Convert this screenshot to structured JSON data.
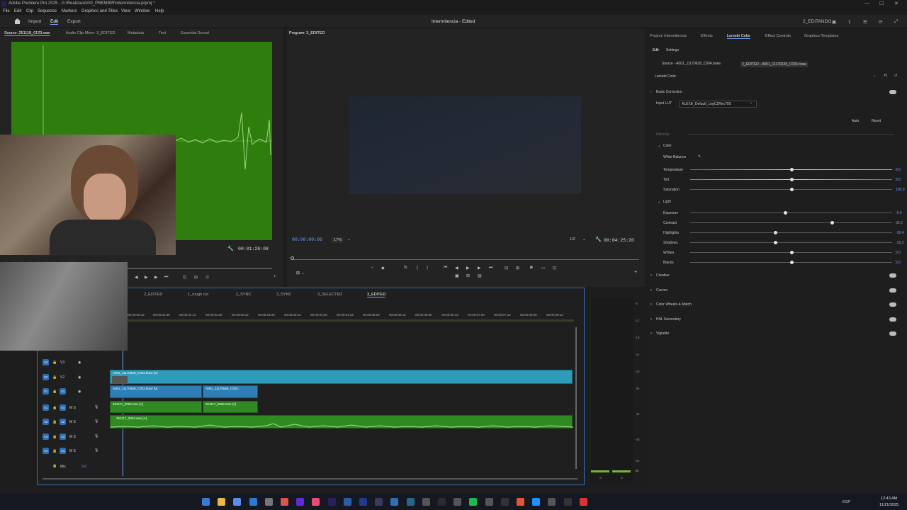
{
  "app": {
    "title": "Adobe Premiere Pro 2025 - G:\\Realización\\0_PREMIER\\Intermitencia.prproj *",
    "project_center_title": "Intermitencia - Edited",
    "workspace_right": "2_EDITANDO"
  },
  "menu": [
    "File",
    "Edit",
    "Clip",
    "Sequence",
    "Markers",
    "Graphics and Titles",
    "View",
    "Window",
    "Help"
  ],
  "workspaces": {
    "import": "Import",
    "edit": "Edit",
    "export": "Export"
  },
  "source_panel": {
    "tabs": [
      "Source: 251118_0123.wav",
      "Audio Clip Mixer: 3_EDITED",
      "Metadata",
      "Text",
      "Essential Sound"
    ],
    "duration": "00:01:28:08"
  },
  "program_panel": {
    "tab": "Program: 3_EDITED",
    "timecode": "00:00:00:06",
    "zoom": "17%",
    "resolution": "1/2",
    "duration": "00:04:25:20"
  },
  "timeline": {
    "tabs": [
      "2_EDITED",
      "1_rough cut",
      "2_SYNC",
      "3_SYNC",
      "3_SELECTED",
      "3_EDITED"
    ],
    "ruler": [
      "00:00:00:12",
      "00:00:01:00",
      "00:00:01:12",
      "00:00:02:00",
      "00:00:02:12",
      "00:00:03:00",
      "00:00:03:12",
      "00:00:04:00",
      "00:00:04:12",
      "00:00:05:00",
      "00:00:05:12",
      "00:00:06:00",
      "00:00:06:12",
      "00:00:07:00",
      "00:00:07:12",
      "00:00:08:00",
      "00:00:08:12"
    ],
    "video_tracks": [
      "V3",
      "V2",
      "V1"
    ],
    "audio_tracks": [
      "A1",
      "A2",
      "A3",
      "A4"
    ],
    "mix_label": "Mix",
    "mix_value": "0.0",
    "clips": {
      "v2": "A001_11170628_C004.braw [V]",
      "v1a": "A001_11170559_C002.braw [V]",
      "v1b": "A001_11170559_C002...",
      "a1a": "251117_0062.wav [A]",
      "a1b": "251117_0062.wav [A]",
      "a2": "251117_0064.wav [A]"
    }
  },
  "meter": {
    "scale": [
      "-6",
      "-12",
      "-18",
      "-24",
      "-30",
      "-36",
      "-42",
      "-48",
      "-54",
      "dB"
    ],
    "footer": [
      "S",
      "S"
    ]
  },
  "right_panel": {
    "tabs": [
      "Project: Intermitencia",
      "Effects",
      "Lumetri Color",
      "Effect Controls",
      "Graphics Templates"
    ],
    "subtabs": [
      "Edit",
      "Settings"
    ],
    "source_clip": "Source - A001_11170628_C004.braw",
    "seq_clip": "3_EDITED - A001_11170628_C004.braw",
    "effect_name": "Lumetri Color",
    "basic_correction": "Basic Correction",
    "input_lut_label": "Input LUT",
    "input_lut_value": "ALEXA_Default_LogC2Rec709",
    "auto": "Auto",
    "reset": "Reset",
    "intensity": "Intensity",
    "color_section": "Color",
    "white_balance": "White Balance",
    "sliders_color": [
      {
        "label": "Temperature",
        "value": "0.0",
        "pos": 0.5
      },
      {
        "label": "Tint",
        "value": "0.0",
        "pos": 0.5
      },
      {
        "label": "Saturation",
        "value": "100.0",
        "pos": 0.5
      }
    ],
    "light_section": "Light",
    "sliders_light": [
      {
        "label": "Exposure",
        "value": "-0.4",
        "pos": 0.47
      },
      {
        "label": "Contrast",
        "value": "39.3",
        "pos": 0.7
      },
      {
        "label": "Highlights",
        "value": "-16.4",
        "pos": 0.42
      },
      {
        "label": "Shadows",
        "value": "-16.2",
        "pos": 0.42
      },
      {
        "label": "Whites",
        "value": "0.0",
        "pos": 0.5
      },
      {
        "label": "Blacks",
        "value": "0.0",
        "pos": 0.5
      }
    ],
    "collapsed_sections": [
      "Creative",
      "Curves",
      "Color Wheels & Match",
      "HSL Secondary",
      "Vignette"
    ]
  },
  "taskbar": {
    "lang": "ESP",
    "time": "12:43 AM",
    "date": "11/21/2025"
  }
}
